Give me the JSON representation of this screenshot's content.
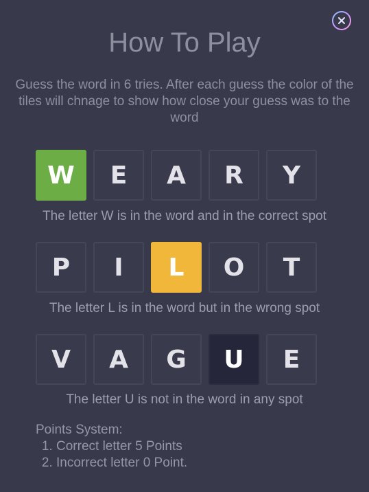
{
  "header": {
    "title": "How To Play",
    "close_icon": "close-icon"
  },
  "intro": "Guess the word in 6 tries. After each guess the color of the tiles will chnage to show how close your guess was to the word",
  "colors": {
    "correct": "#6cae45",
    "present": "#f0b73a",
    "absent": "#25263a",
    "background": "#383a4c"
  },
  "examples": [
    {
      "letters": [
        "W",
        "E",
        "A",
        "R",
        "Y"
      ],
      "states": [
        "correct",
        "empty",
        "empty",
        "empty",
        "empty"
      ],
      "caption": "The letter W is in the word and in the correct spot"
    },
    {
      "letters": [
        "P",
        "I",
        "L",
        "O",
        "T"
      ],
      "states": [
        "empty",
        "empty",
        "present",
        "empty",
        "empty"
      ],
      "caption": "The letter L is in the word but in the wrong spot"
    },
    {
      "letters": [
        "V",
        "A",
        "G",
        "U",
        "E"
      ],
      "states": [
        "empty",
        "empty",
        "empty",
        "absent",
        "empty"
      ],
      "caption": "The letter U is not in the word in any spot"
    }
  ],
  "points": {
    "heading": "Points System:",
    "items": [
      "Correct letter 5 Points",
      "Incorrect letter 0 Point."
    ]
  }
}
